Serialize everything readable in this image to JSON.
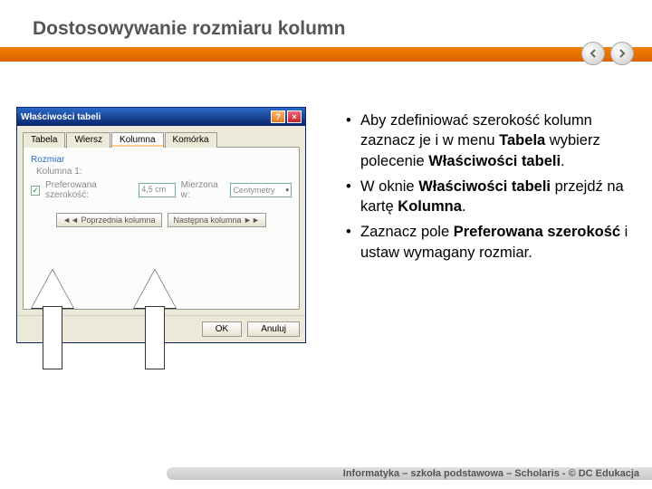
{
  "title": "Dostosowywanie rozmiaru kolumn",
  "dialog": {
    "title": "Właściwości tabeli",
    "tabs": [
      "Tabela",
      "Wiersz",
      "Kolumna",
      "Komórka"
    ],
    "active_tab": "Kolumna",
    "group": "Rozmiar",
    "col_label": "Kolumna 1:",
    "pref_width_label": "Preferowana szerokość:",
    "pref_width_value": "4,5 cm",
    "measure_label": "Mierzona w:",
    "measure_value": "Centymetry",
    "prev_col": "◄◄ Poprzednia kolumna",
    "next_col": "Następna kolumna ►►",
    "ok": "OK",
    "cancel": "Anuluj"
  },
  "bullets": [
    {
      "pre": "Aby zdefiniować szerokość kolumn zaznacz je i w menu ",
      "b1": "Tabela",
      "mid": " wybierz polecenie ",
      "b2": "Właściwości tabeli",
      "post": "."
    },
    {
      "pre": "W oknie ",
      "b1": "Właściwości tabeli",
      "mid": " przejdź na kartę ",
      "b2": "Kolumna",
      "post": "."
    },
    {
      "pre": "Zaznacz pole ",
      "b1": "Preferowana szerokość",
      "mid": " i ustaw wymagany rozmiar.",
      "b2": "",
      "post": ""
    }
  ],
  "footer": "Informatyka – szkoła podstawowa – Scholaris - © DC Edukacja"
}
